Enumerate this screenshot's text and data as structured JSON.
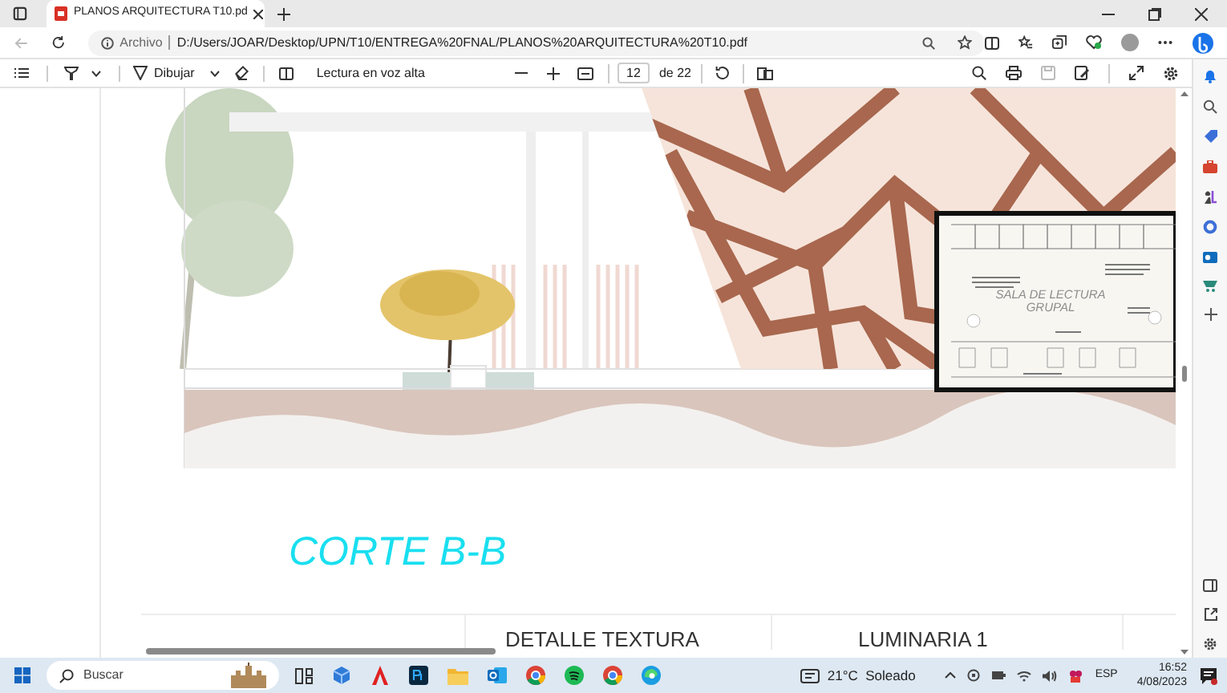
{
  "browser": {
    "tab_title": "PLANOS ARQUITECTURA T10.pd",
    "address_label": "Archivo",
    "url": "D:/Users/JOAR/Desktop/UPN/T10/ENTREGA%20FNAL/PLANOS%20ARQUITECTURA%20T10.pdf"
  },
  "pdf_toolbar": {
    "draw_label": "Dibujar",
    "read_aloud": "Lectura en voz alta",
    "page": "12",
    "page_total": "de 22"
  },
  "drawing": {
    "room_label": [
      "SALA DE LECTURA",
      "GRUPAL"
    ],
    "section_title": "CORTE B-B",
    "table_headers": [
      "DETALLE TEXTURA",
      "LUMINARIA 1"
    ]
  },
  "taskbar": {
    "search_placeholder": "Buscar",
    "weather": "21°C  Soleado",
    "language": "ESP",
    "time": "16:52",
    "date": "4/08/2023"
  }
}
